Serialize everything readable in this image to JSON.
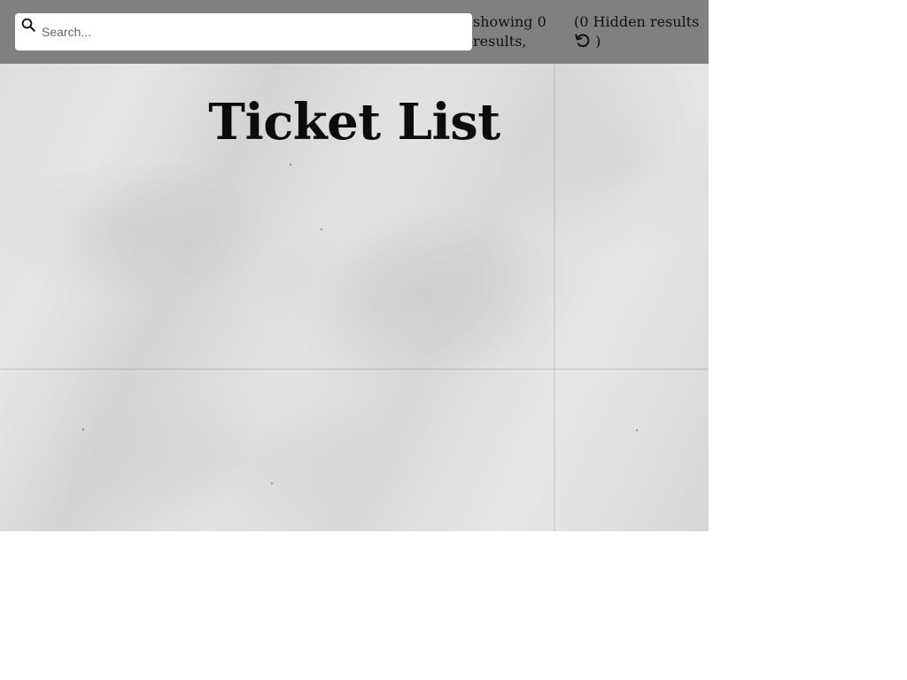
{
  "search": {
    "placeholder": "Search...",
    "value": ""
  },
  "status": {
    "results_text": "showing 0 results,",
    "hidden_prefix": "(0 Hidden results",
    "hidden_suffix": ")"
  },
  "main": {
    "title": "Ticket List"
  },
  "icons": {
    "search": "search-icon",
    "reset": "undo-icon"
  },
  "colors": {
    "header_bg": "#808080",
    "search_bg": "#ffffff",
    "text": "#111111"
  }
}
